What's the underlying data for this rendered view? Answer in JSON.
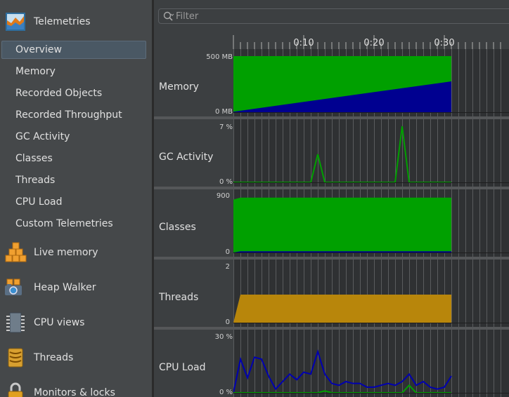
{
  "sidebar": {
    "header": {
      "label": "Telemetries",
      "icon": "telemetries-icon"
    },
    "items": [
      {
        "label": "Overview",
        "selected": true
      },
      {
        "label": "Memory"
      },
      {
        "label": "Recorded Objects"
      },
      {
        "label": "Recorded Throughput"
      },
      {
        "label": "GC Activity"
      },
      {
        "label": "Classes"
      },
      {
        "label": "Threads"
      },
      {
        "label": "CPU Load"
      },
      {
        "label": "Custom Telemetries"
      }
    ],
    "sections": [
      {
        "label": "Live memory",
        "icon": "live-memory-icon"
      },
      {
        "label": "Heap Walker",
        "icon": "heap-walker-icon"
      },
      {
        "label": "CPU views",
        "icon": "cpu-views-icon"
      },
      {
        "label": "Threads",
        "icon": "threads-icon"
      },
      {
        "label": "Monitors & locks",
        "icon": "monitors-locks-icon"
      }
    ]
  },
  "filter": {
    "placeholder": "Filter",
    "value": ""
  },
  "timeline": {
    "ticks": [
      "0:10",
      "0:20",
      "0:30"
    ]
  },
  "charts": {
    "memory": {
      "label": "Memory",
      "ymax": "500 MB",
      "ymin": "0 MB"
    },
    "gc": {
      "label": "GC Activity",
      "ymax": "7 %",
      "ymin": "0 %"
    },
    "classes": {
      "label": "Classes",
      "ymax": "900",
      "ymin": "0"
    },
    "threads": {
      "label": "Threads",
      "ymax": "2",
      "ymin": "0"
    },
    "cpu": {
      "label": "CPU Load",
      "ymax": "30 %",
      "ymin": "0 %"
    }
  },
  "chart_data": [
    {
      "type": "area",
      "name": "memory",
      "ylabel": "",
      "ylim": [
        0,
        500
      ],
      "x": [
        0,
        31
      ],
      "series": [
        {
          "values": [
            500,
            500
          ],
          "color": "#00a000"
        },
        {
          "values": [
            5,
            275
          ],
          "color": "#000090"
        }
      ]
    },
    {
      "type": "line",
      "name": "gc",
      "ylim": [
        0,
        7
      ],
      "x": [
        0,
        11,
        12,
        13,
        23,
        24,
        25,
        31
      ],
      "series": [
        {
          "values": [
            0,
            0,
            3.5,
            0,
            0,
            7,
            0,
            0
          ],
          "color": "#00a000"
        }
      ]
    },
    {
      "type": "area",
      "name": "classes",
      "ylim": [
        0,
        900
      ],
      "x": [
        0,
        1,
        31
      ],
      "series": [
        {
          "values": [
            850,
            880,
            880
          ],
          "color": "#00a000"
        },
        {
          "values": [
            0,
            20,
            20
          ],
          "color": "#000090"
        }
      ]
    },
    {
      "type": "area",
      "name": "threads",
      "ylim": [
        0,
        2
      ],
      "x": [
        0,
        1,
        31
      ],
      "series": [
        {
          "values": [
            0,
            1,
            1
          ],
          "color": "#b8860b"
        }
      ]
    },
    {
      "type": "line",
      "name": "cpu",
      "ylim": [
        0,
        30
      ],
      "x": [
        0,
        1,
        2,
        3,
        4,
        5,
        6,
        7,
        8,
        9,
        10,
        11,
        12,
        13,
        14,
        15,
        16,
        17,
        18,
        19,
        20,
        21,
        22,
        23,
        24,
        25,
        26,
        27,
        28,
        29,
        30,
        31
      ],
      "series": [
        {
          "values": [
            0,
            18,
            8,
            19,
            18,
            9,
            2,
            6,
            10,
            7,
            11,
            10,
            22,
            10,
            5,
            4,
            6,
            5,
            5,
            3,
            3,
            4,
            5,
            4,
            6,
            10,
            4,
            6,
            3,
            2,
            3,
            9
          ],
          "color": "#0000b0"
        },
        {
          "values": [
            0,
            0,
            0,
            0,
            0,
            0,
            0,
            0,
            0,
            0,
            0,
            0,
            0,
            1,
            0,
            0,
            0,
            0,
            0,
            0,
            0,
            0,
            0,
            0,
            0,
            4,
            0,
            0,
            0,
            0,
            0,
            0
          ],
          "color": "#00a000"
        }
      ]
    }
  ]
}
